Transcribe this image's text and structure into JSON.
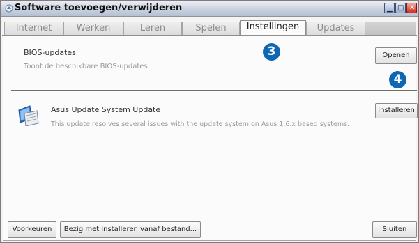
{
  "window": {
    "title": "Software toevoegen/verwijderen",
    "controls": [
      "minimize-icon",
      "maximize-icon",
      "close-icon"
    ]
  },
  "tabs": [
    {
      "label": "Internet",
      "active": false
    },
    {
      "label": "Werken",
      "active": false
    },
    {
      "label": "Leren",
      "active": false
    },
    {
      "label": "Spelen",
      "active": false
    },
    {
      "label": "Instellingen",
      "active": true
    },
    {
      "label": "Updates",
      "active": false
    }
  ],
  "bios": {
    "title": "BIOS-updates",
    "description": "Toont de beschikbare BIOS-updates",
    "button": "Openen"
  },
  "update": {
    "icon": "software-update-icon",
    "title": "Asus Update System Update",
    "description": "This update resolves several issues with the update system on Asus 1.6.x based systems.",
    "button": "Installeren"
  },
  "footer": {
    "preferences": "Voorkeuren",
    "install_from_file": "Bezig met installeren vanaf bestand...",
    "close": "Sluiten"
  },
  "markers": [
    "3",
    "4"
  ],
  "colors": {
    "marker": "#0d67b3",
    "titlebar": "#cfd6e3",
    "close_button": "#d0301c"
  }
}
